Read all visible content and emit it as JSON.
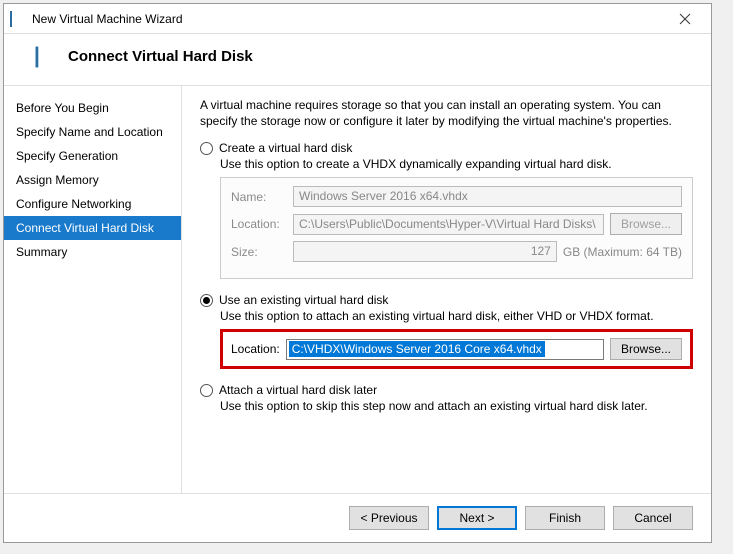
{
  "window": {
    "title": "New Virtual Machine Wizard"
  },
  "header": {
    "heading": "Connect Virtual Hard Disk"
  },
  "sidebar": {
    "items": [
      {
        "label": "Before You Begin"
      },
      {
        "label": "Specify Name and Location"
      },
      {
        "label": "Specify Generation"
      },
      {
        "label": "Assign Memory"
      },
      {
        "label": "Configure Networking"
      },
      {
        "label": "Connect Virtual Hard Disk"
      },
      {
        "label": "Summary"
      }
    ]
  },
  "content": {
    "intro": "A virtual machine requires storage so that you can install an operating system. You can specify the storage now or configure it later by modifying the virtual machine's properties.",
    "opt_create": {
      "label": "Create a virtual hard disk",
      "desc": "Use this option to create a VHDX dynamically expanding virtual hard disk.",
      "name_label": "Name:",
      "name_value": "Windows Server 2016 x64.vhdx",
      "loc_label": "Location:",
      "loc_value": "C:\\Users\\Public\\Documents\\Hyper-V\\Virtual Hard Disks\\",
      "browse_label": "Browse...",
      "size_label": "Size:",
      "size_value": "127",
      "size_unit": "GB (Maximum: 64 TB)"
    },
    "opt_existing": {
      "label": "Use an existing virtual hard disk",
      "desc": "Use this option to attach an existing virtual hard disk, either VHD or VHDX format.",
      "loc_label": "Location:",
      "loc_value": "C:\\VHDX\\Windows Server 2016 Core x64.vhdx",
      "browse_label": "Browse..."
    },
    "opt_later": {
      "label": "Attach a virtual hard disk later",
      "desc": "Use this option to skip this step now and attach an existing virtual hard disk later."
    }
  },
  "footer": {
    "previous": "< Previous",
    "next": "Next >",
    "finish": "Finish",
    "cancel": "Cancel"
  }
}
